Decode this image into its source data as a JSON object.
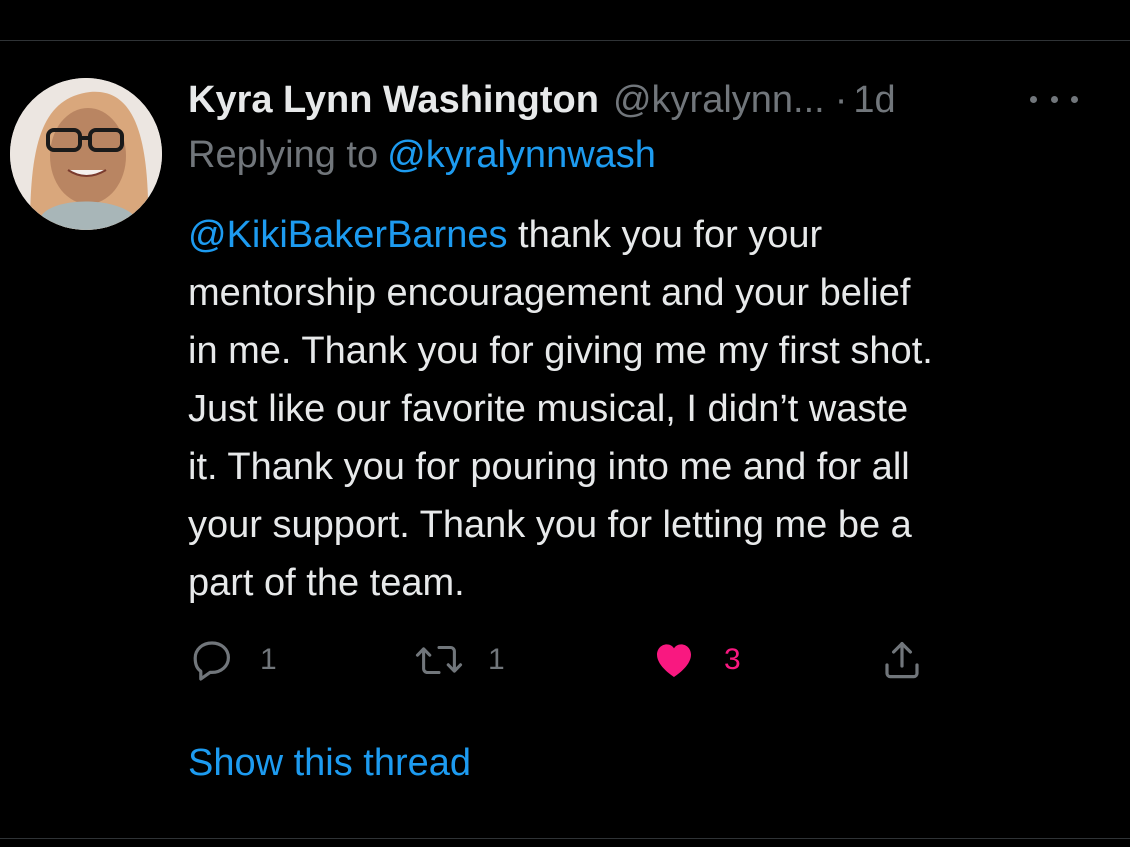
{
  "tweet": {
    "display_name": "Kyra Lynn Washington",
    "handle": "@kyralynn...",
    "separator": "·",
    "time": "1d",
    "more_icon": "more-horizontal-icon",
    "replying_prefix": "Replying to",
    "replying_to": "@kyralynnwash",
    "body_mention": "@KikiBakerBarnes",
    "body_lines": [
      " thank you for your",
      "mentorship encouragement and your belief",
      "in me. Thank you for giving me my first shot.",
      "Just like our favorite musical, I didn’t waste",
      "it. Thank you for pouring into me and for all",
      "your support. Thank you for letting me be a",
      "part of the team."
    ],
    "actions": {
      "reply_count": "1",
      "retweet_count": "1",
      "like_count": "3",
      "liked": true
    },
    "show_thread": "Show this thread"
  },
  "colors": {
    "background": "#000000",
    "text": "#e7e9ea",
    "secondary": "#71767b",
    "link": "#1d9bf0",
    "like": "#f91880",
    "divider": "#2f3336"
  }
}
